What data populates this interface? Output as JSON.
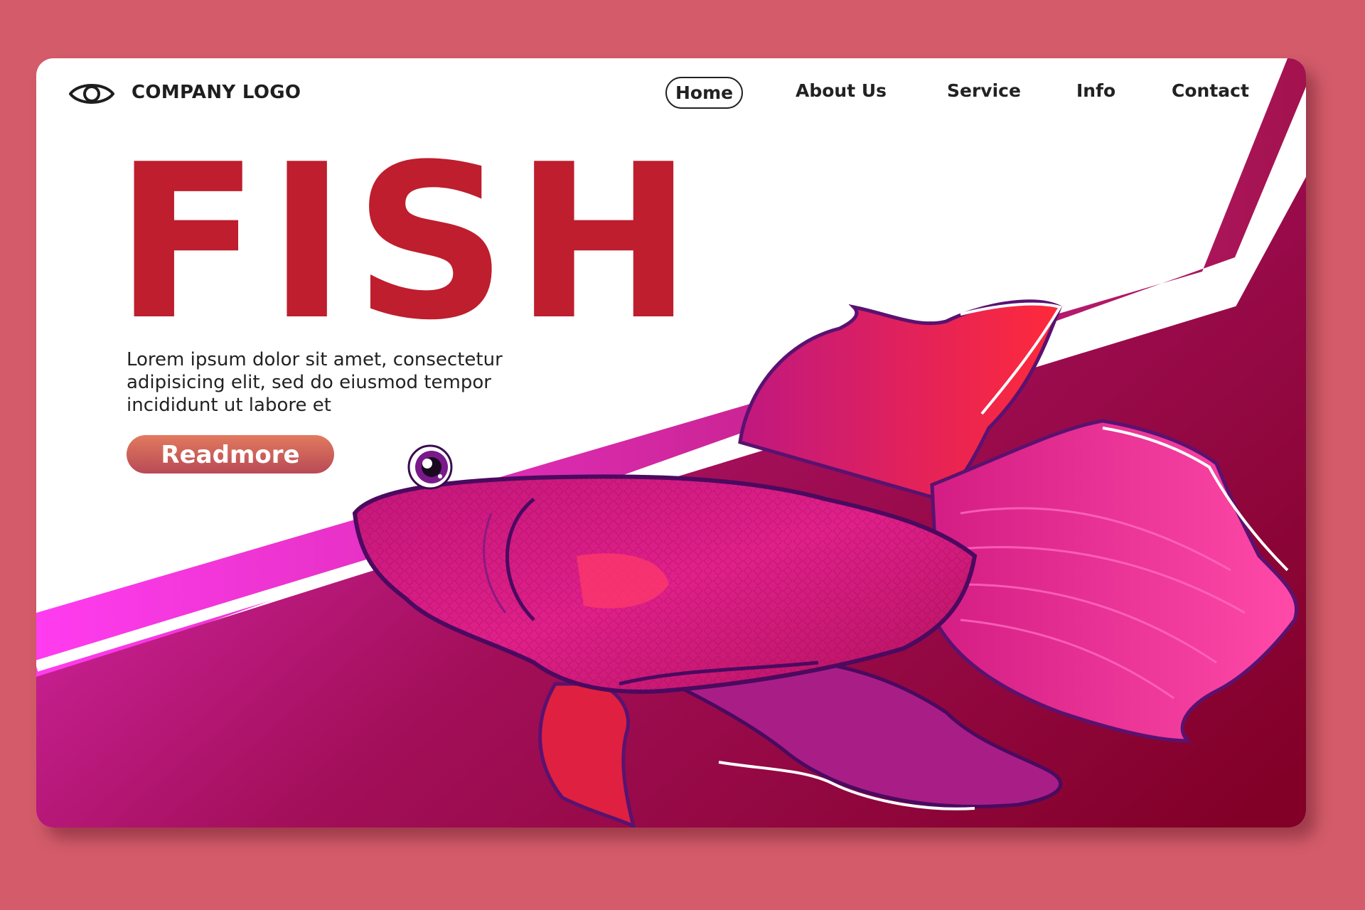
{
  "brand": {
    "logo_text": "COMPANY LOGO",
    "logo_icon": "eye-icon"
  },
  "nav": {
    "items": [
      {
        "label": "Home",
        "active": true
      },
      {
        "label": "About Us"
      },
      {
        "label": "Service"
      },
      {
        "label": "Info"
      },
      {
        "label": "Contact"
      }
    ]
  },
  "hero": {
    "title": "FISH",
    "body": "Lorem ipsum dolor sit amet, consectetur adipisicing elit, sed do eiusmod tempor incididunt ut labore et",
    "cta_label": "Readmore"
  },
  "colors": {
    "page_background": "#d45c6a",
    "title": "#be1e2d",
    "band_gradient_start": "#ff3cf0",
    "band_gradient_end": "#8a0030",
    "fish_body": "#d4197e",
    "fins": "#e8203a"
  }
}
